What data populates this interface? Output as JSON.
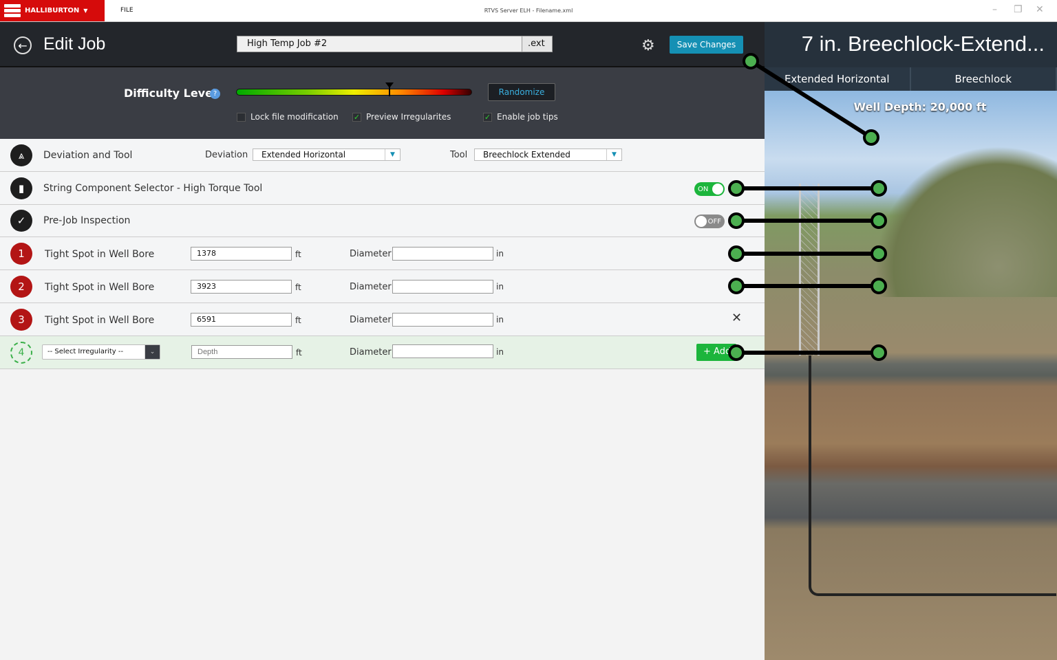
{
  "titlebar": {
    "brand": "HALLIBURTON",
    "brand_caret": "▼",
    "file_menu": "FILE",
    "window_title": "RTVS Server ELH - Filename.xml"
  },
  "header": {
    "back_icon": "back-arrow-icon",
    "title": "Edit Job",
    "job_name": "High Temp Job #2",
    "extension": ".ext",
    "save_label": "Save Changes"
  },
  "difficulty": {
    "label": "Difficulty Level",
    "help": "?",
    "level_fraction": 0.65,
    "randomize_label": "Randomize",
    "options": [
      {
        "label": "Lock file modification",
        "checked": false
      },
      {
        "label": "Preview Irregularites",
        "checked": true
      },
      {
        "label": "Enable job tips",
        "checked": true
      }
    ]
  },
  "rows": {
    "deviation": {
      "label": "Deviation and Tool",
      "deviation_label": "Deviation",
      "deviation_value": "Extended Horizontal",
      "tool_label": "Tool",
      "tool_value": "Breechlock Extended"
    },
    "string": {
      "label": "String Component Selector - High Torque Tool",
      "toggle": "ON"
    },
    "prejob": {
      "label": "Pre-Job Inspection",
      "toggle": "OFF"
    },
    "irregularities": [
      {
        "num": "1",
        "label": "Tight Spot in Well Bore",
        "depth": "1378",
        "unit": "ft",
        "diameter_label": "Diameter",
        "diameter": "",
        "diameter_unit": "in"
      },
      {
        "num": "2",
        "label": "Tight Spot in Well Bore",
        "depth": "3923",
        "unit": "ft",
        "diameter_label": "Diameter",
        "diameter": "",
        "diameter_unit": "in"
      },
      {
        "num": "3",
        "label": "Tight Spot in Well Bore",
        "depth": "6591",
        "unit": "ft",
        "diameter_label": "Diameter",
        "diameter": "",
        "diameter_unit": "in"
      }
    ],
    "new": {
      "num": "4",
      "select_placeholder": "-- Select Irregularity --",
      "depth_placeholder": "Depth",
      "unit": "ft",
      "diameter_label": "Diameter",
      "diameter_unit": "in",
      "add_label": "+ Add"
    }
  },
  "preview": {
    "title": "7 in. Breechlock-Extend...",
    "tabs": [
      "Extended Horizontal",
      "Breechlock"
    ],
    "well_depth": "Well Depth: 20,000 ft"
  },
  "colors": {
    "brand": "#d60b0b",
    "accent": "#1590b4",
    "success": "#1cb53c",
    "danger": "#b31515"
  }
}
